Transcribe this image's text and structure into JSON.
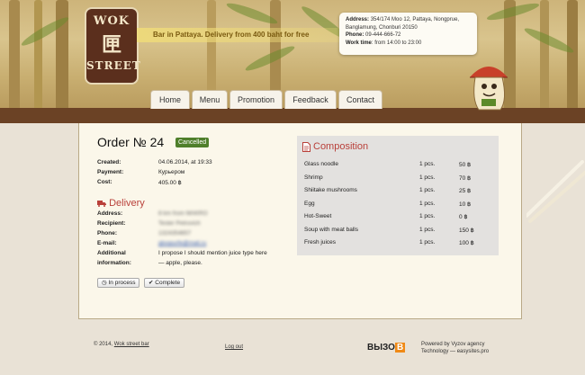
{
  "header": {
    "logo": {
      "line1": "WOK",
      "line2": "匣",
      "line3": "STREET"
    },
    "tagline": "Bar in Pattaya. Delivery from 400 baht for free",
    "contact": {
      "address_label": "Address:",
      "address": "354/174 Moo 12, Pattaya, Nongprue, Banglamung, Chonburi 20150",
      "phone_label": "Phone:",
      "phone": "09-444-666-72",
      "hours_label": "Work time",
      "hours": ": from 14:00 to 23:00"
    },
    "nav": [
      "Home",
      "Menu",
      "Promotion",
      "Feedback",
      "Contact"
    ]
  },
  "order": {
    "title": "Order № 24",
    "status": "Cancelled",
    "created_label": "Created:",
    "created": "04.06.2014, at 19:33",
    "payment_label": "Payment:",
    "payment": "Курьером",
    "cost_label": "Cost:",
    "cost": "405.00 ฿"
  },
  "delivery": {
    "title": "Delivery",
    "address_label": "Address:",
    "address": "8 km from MAKRO",
    "recipient_label": "Recipient:",
    "recipient": "Tester Petrovich",
    "phone_label": "Phone:",
    "phone": "1324354657",
    "email_label": "E-mail:",
    "email": "gloopurfe@mail.ru",
    "additional_label_1": "Additional",
    "additional_label_2": "information:",
    "additional_1": "I propose I should mention juice type here",
    "additional_2": "— apple, please."
  },
  "actions": {
    "in_process": "In process",
    "complete": "Complete"
  },
  "composition": {
    "title": "Composition",
    "items": [
      {
        "name": "Glass noodle",
        "qty": "1 pcs.",
        "price": "50 ฿"
      },
      {
        "name": "Shrimp",
        "qty": "1 pcs.",
        "price": "70 ฿"
      },
      {
        "name": "Shiitake mushrooms",
        "qty": "1 pcs.",
        "price": "25 ฿"
      },
      {
        "name": "Egg",
        "qty": "1 pcs.",
        "price": "10 ฿"
      },
      {
        "name": "Hot-Sweet",
        "qty": "1 pcs.",
        "price": "0 ฿"
      },
      {
        "name": "Soup with meat balls",
        "qty": "1 pcs.",
        "price": "150 ฿"
      },
      {
        "name": "Fresh juices",
        "qty": "1 pcs.",
        "price": "100 ฿"
      }
    ]
  },
  "footer": {
    "copyright": "© 2014,",
    "site_link": "Wok street bar",
    "logout": "Log out",
    "agency_logo_1": "ВЫЗО",
    "agency_logo_2": "В",
    "powered": "Powered by Vyzov agency",
    "technology": "Technology — easysites.pro"
  },
  "colors": {
    "accent_red": "#b9403a",
    "status_green": "#4f7f2b",
    "header_brown": "#6b4225",
    "agency_orange": "#f08a16"
  },
  "icons": [
    "truck-icon",
    "document-icon",
    "clock-icon",
    "check-icon"
  ]
}
